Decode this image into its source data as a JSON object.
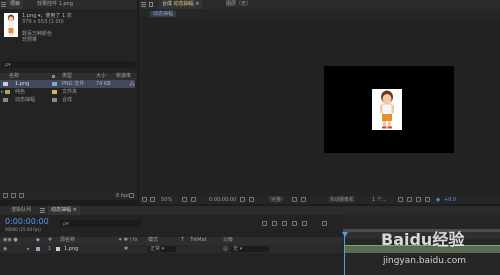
{
  "project_panel": {
    "tab_project": "项目",
    "tab_effect": "效果控件 1.png",
    "preview": {
      "file_name": "1.png",
      "used_count": "，使用了 1 次",
      "dimensions": "379 x 553 (1.00)",
      "color_info": "数百万种颜色",
      "alpha_info": "非预乘"
    },
    "search_placeholder": "ρ▾",
    "columns": {
      "name": "名称",
      "type": "类型",
      "size": "大小",
      "frame_rate": "帧速率"
    },
    "items": [
      {
        "name": "1.png",
        "type": "PNG 文件",
        "size": "74 KB",
        "swatch": "#8aa7c6",
        "kind": "file"
      },
      {
        "name": "纯色",
        "type": "文件夹",
        "size": "",
        "swatch": "#d4b35b",
        "kind": "folder"
      },
      {
        "name": "动态抽幅",
        "type": "合成",
        "size": "",
        "swatch": "#8a8a8a",
        "kind": "comp"
      }
    ],
    "bit_depth": "8 bpc"
  },
  "comp_panel": {
    "tab_comp_prefix": "合成",
    "tab_comp_name": "动态抽幅",
    "tab_layer": "图层（无）",
    "breadcrumb": "动态抽幅",
    "zoom": "50%",
    "timecode": "0:00:00:00",
    "resolution": "（完整）",
    "view": "活动摄像机",
    "views_count": "1 个...",
    "exposure": "+0.0"
  },
  "timeline": {
    "tab_render": "渲染队列",
    "tab_comp": "动态抽幅",
    "timecode": "0:00:00:00",
    "frame_info": "00000 (25.00 fps)",
    "search_placeholder": "ρ▾",
    "columns": {
      "num": "#",
      "source": "源名称",
      "mode": "模式",
      "t": "T",
      "trkmat": "TrkMat",
      "parent": "父级"
    },
    "layers": [
      {
        "num": "1",
        "name": "1.png",
        "mode": "正常",
        "parent": "无"
      }
    ]
  },
  "watermark": {
    "brand": "Baidu经验",
    "url": "jingyan.baidu.com"
  }
}
